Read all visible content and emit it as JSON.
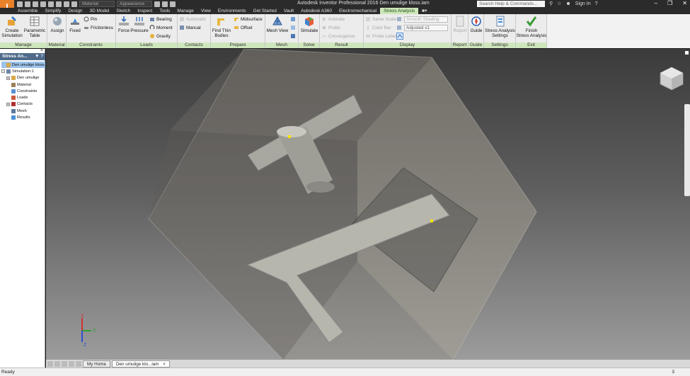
{
  "window": {
    "title": "Autodesk Inventor Professional 2016   Den umulige kloss.iam",
    "search_placeholder": "Search Help & Commands...",
    "sign_in": "Sign In",
    "app_logo_letter": "I",
    "material_select": "Material",
    "appearance_select": "Appearance"
  },
  "tabs": [
    "Assemble",
    "Simplify",
    "Design",
    "3D Model",
    "Sketch",
    "Inspect",
    "Tools",
    "Manage",
    "View",
    "Environments",
    "Get Started",
    "Vault",
    "Autodesk A360",
    "Electromechanical",
    "Stress Analysis"
  ],
  "active_tab": "Stress Analysis",
  "ribbon": {
    "manage": {
      "title": "Manage",
      "create_simulation": "Create\nSimulation",
      "parametric_table": "Parametric\nTable"
    },
    "material": {
      "title": "Material",
      "assign": "Assign"
    },
    "constraints": {
      "title": "Constraints",
      "fixed": "Fixed",
      "pin": "Pin",
      "frictionless": "Frictionless"
    },
    "loads": {
      "title": "Loads",
      "force": "Force",
      "pressure": "Pressure",
      "bearing": "Bearing",
      "moment": "Moment",
      "gravity": "Gravity"
    },
    "contacts": {
      "title": "Contacts",
      "automatic": "Automatic",
      "manual": "Manual"
    },
    "prepare": {
      "title": "Prepare",
      "find_thin_bodies": "Find Thin\nBodies",
      "midsurface": "Midsurface",
      "offset": "Offset"
    },
    "mesh": {
      "title": "Mesh",
      "mesh_view": "Mesh View"
    },
    "solve": {
      "title": "Solve",
      "simulate": "Simulate"
    },
    "result": {
      "title": "Result",
      "animate": "Animate",
      "probe": "Probe",
      "convergence": "Convergence"
    },
    "display": {
      "title": "Display",
      "same_scale": "Same Scale",
      "color_bar": "Color Bar",
      "probe_labels": "Probe Labels",
      "smooth_shading": "Smooth Shading",
      "adjusted": "Adjusted x1"
    },
    "report": {
      "title": "Report",
      "report": "Report"
    },
    "guide": {
      "title": "Guide",
      "guide": "Guide"
    },
    "settings": {
      "title": "Settings",
      "stress_analysis_settings": "Stress Analysis\nSettings"
    },
    "exit": {
      "title": "Exit",
      "finish": "Finish\nStress Analysis"
    }
  },
  "browser": {
    "title": "Stress An...",
    "items": [
      {
        "label": "Den umulige kloss.iz",
        "indent": 0,
        "selected": true,
        "expander": ""
      },
      {
        "label": "Simulation:1",
        "indent": 0,
        "selected": false,
        "expander": "-"
      },
      {
        "label": "Den umulige",
        "indent": 1,
        "selected": false,
        "expander": "+"
      },
      {
        "label": "Material",
        "indent": 1,
        "selected": false,
        "expander": ""
      },
      {
        "label": "Constraints",
        "indent": 1,
        "selected": false,
        "expander": ""
      },
      {
        "label": "Loads",
        "indent": 1,
        "selected": false,
        "expander": ""
      },
      {
        "label": "Contacts",
        "indent": 1,
        "selected": false,
        "expander": "+"
      },
      {
        "label": "Mesh",
        "indent": 1,
        "selected": false,
        "expander": ""
      },
      {
        "label": "Results",
        "indent": 1,
        "selected": false,
        "expander": ""
      }
    ]
  },
  "axes": {
    "x": "X",
    "y": "Y",
    "z": "Z"
  },
  "doc_tabs": {
    "home": "My Home",
    "doc": "Den umulige klo...iam"
  },
  "status": {
    "text": "Ready",
    "count": "3"
  },
  "colors": {
    "accent_green": "#cfe6bd",
    "logo_orange": "#e8812a",
    "browser_head": "#4f6b8a"
  }
}
